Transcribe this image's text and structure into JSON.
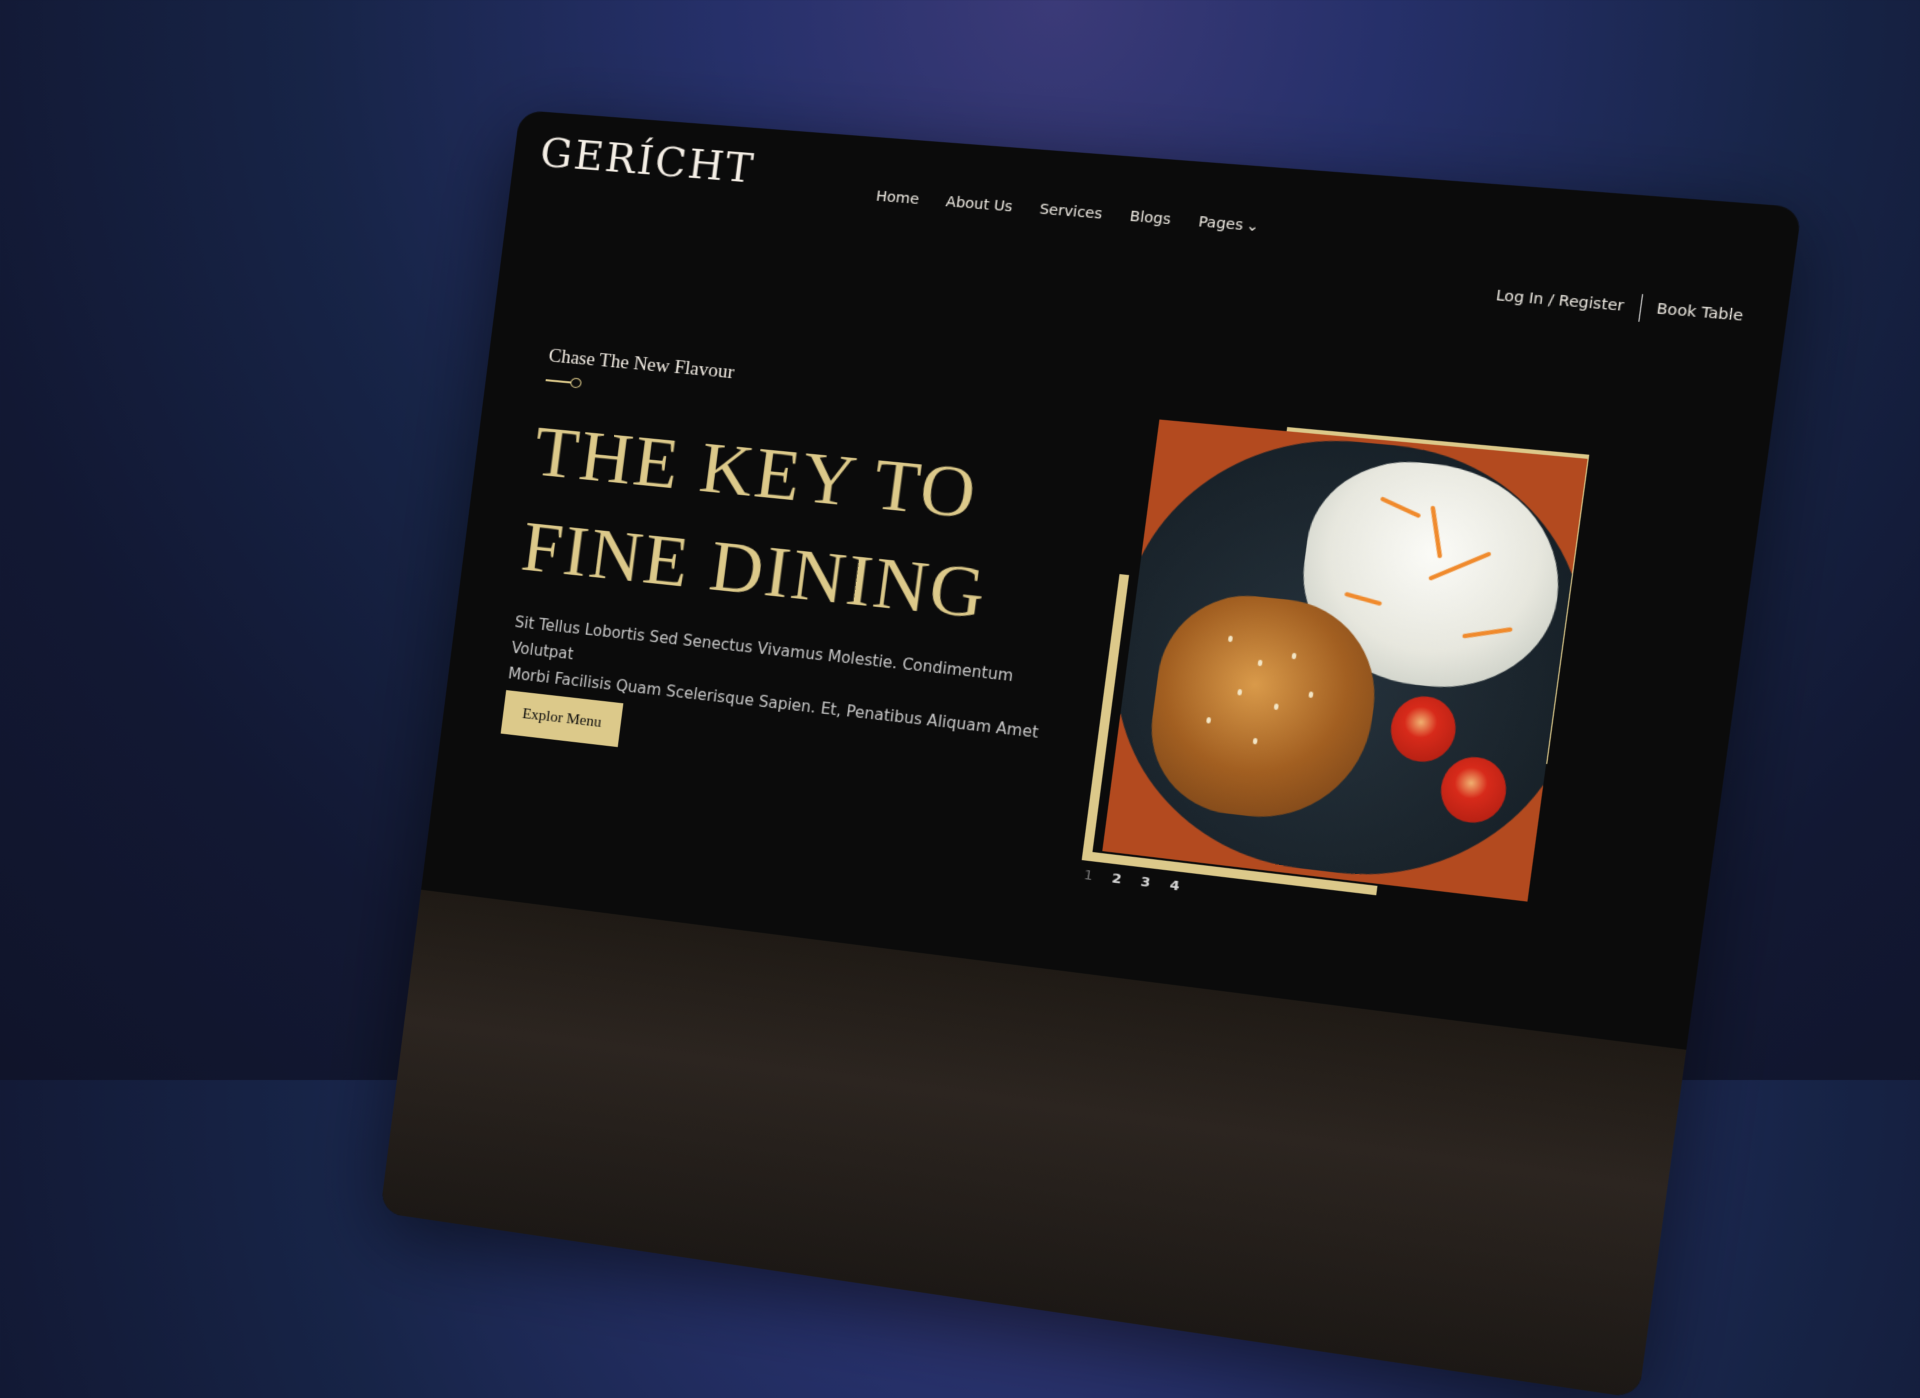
{
  "header": {
    "logo": "GERÍCHT",
    "nav": [
      {
        "label": "Home"
      },
      {
        "label": "About Us"
      },
      {
        "label": "Services"
      },
      {
        "label": "Blogs"
      },
      {
        "label": "Pages"
      }
    ],
    "login_label": "Log In / Register",
    "book_label": "Book Table"
  },
  "hero": {
    "subtitle": "Chase The New Flavour",
    "headline_line1": "THE KEY TO",
    "headline_line2": "FINE DINING",
    "body_line1": "Sit Tellus Lobortis Sed Senectus Vivamus Molestie. Condimentum Volutpat",
    "body_line2": "Morbi Facilisis Quam Scelerisque Sapien. Et, Penatibus Aliquam Amet Tellus",
    "cta_label": "Explor Menu"
  },
  "slider": {
    "pages": [
      "1",
      "2",
      "3",
      "4"
    ],
    "active_index": 0
  },
  "colors": {
    "accent": "#dcc98a",
    "background": "#0b0b0b",
    "text": "#f0ece4"
  },
  "icons": {
    "pages_caret": "chevron-down-icon",
    "subtitle_decoration": "spoon-icon"
  }
}
